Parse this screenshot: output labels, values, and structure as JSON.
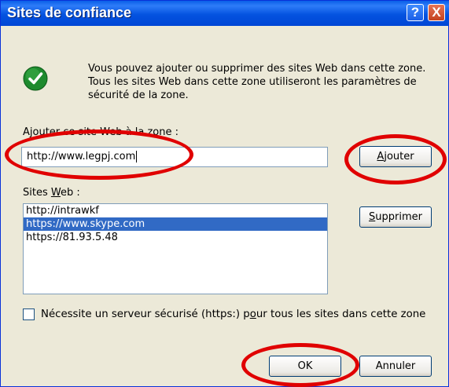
{
  "window": {
    "title": "Sites de confiance"
  },
  "titlebar": {
    "help_glyph": "?",
    "close_glyph": "X"
  },
  "info_icon": "check-icon",
  "info_text": "Vous pouvez ajouter ou supprimer des sites Web dans cette zone. Tous les sites Web dans cette zone utiliseront les paramètres de sécurité de la zone.",
  "add_label": "Ajouter ce site Web à la zone :",
  "add_input": {
    "value": "http://www.legpj.com"
  },
  "buttons": {
    "add": {
      "u": "A",
      "rest": "jouter"
    },
    "remove": {
      "u": "S",
      "rest": "upprimer"
    },
    "ok": "OK",
    "cancel": "Annuler"
  },
  "sites_label": {
    "pre": "Sites ",
    "u": "W",
    "rest": "eb :"
  },
  "sites": [
    {
      "url": "http://intrawkf",
      "selected": false
    },
    {
      "url": "https://www.skype.com",
      "selected": true
    },
    {
      "url": "https://81.93.5.48",
      "selected": false
    }
  ],
  "https_checkbox": {
    "checked": false,
    "pre": "Nécessite un serveur sécurisé (https:) p",
    "u": "o",
    "rest": "ur tous les sites dans cette zone"
  },
  "colors": {
    "title_bar": "#0A5FE8",
    "dialog_bg": "#ECE9D8",
    "selection": "#316AC5",
    "annotation": "#E00000"
  }
}
